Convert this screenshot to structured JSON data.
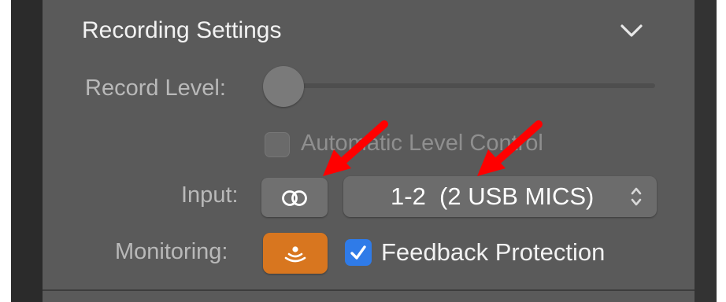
{
  "section": {
    "title": "Recording Settings",
    "collapse_icon": "chevron-down-icon"
  },
  "record_level": {
    "label": "Record Level:",
    "level": 0
  },
  "automatic_level_control": {
    "label": "Automatic Level Control",
    "checked": false,
    "enabled": false
  },
  "input": {
    "label": "Input:",
    "channel_mode_icon": "stereo-icon",
    "selected_value": "1-2  (2 USB MICS)",
    "select_icon": "up-down-chevron-icon"
  },
  "monitoring": {
    "label": "Monitoring:",
    "button_icon": "monitoring-icon",
    "active": true,
    "active_color": "#d8761f"
  },
  "feedback_protection": {
    "label": "Feedback Protection",
    "checked": true,
    "check_color": "#2f7be8"
  },
  "annotation": {
    "arrow_color": "#ff0000"
  }
}
